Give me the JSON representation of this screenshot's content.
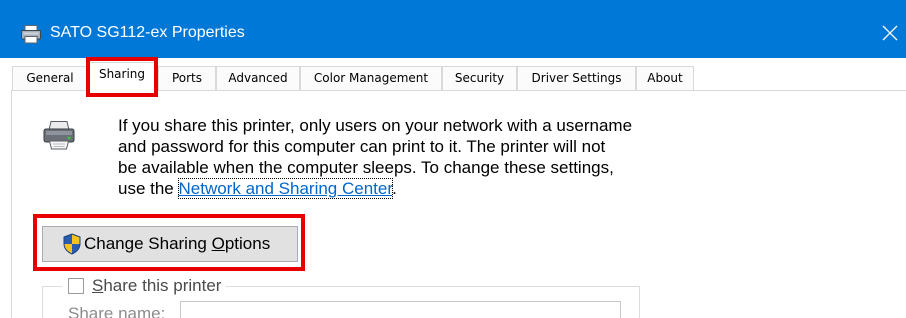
{
  "window": {
    "title": "SATO SG112-ex Properties",
    "title_icon": "printer-icon",
    "close_icon": "close-icon"
  },
  "tabs": [
    {
      "label": "General",
      "selected": false
    },
    {
      "label": "Sharing",
      "selected": true
    },
    {
      "label": "Ports",
      "selected": false
    },
    {
      "label": "Advanced",
      "selected": false
    },
    {
      "label": "Color Management",
      "selected": false
    },
    {
      "label": "Security",
      "selected": false
    },
    {
      "label": "Driver Settings",
      "selected": false
    },
    {
      "label": "About",
      "selected": false
    }
  ],
  "sharing": {
    "printer_icon": "printer-icon",
    "description_lines": [
      "If you share this printer, only users on your network with a username",
      "and password for this computer can print to it. The printer will not",
      "be available when the computer sleeps. To change these settings,"
    ],
    "description_last_prefix": "use the ",
    "link_text": "Network and Sharing Center",
    "description_last_suffix": ".",
    "change_button": {
      "label": "Change Sharing Options",
      "access_key": "O",
      "icon": "uac-shield-icon"
    },
    "share_checkbox": {
      "label": "Share this printer",
      "access_key": "S",
      "checked": false
    },
    "share_name": {
      "label": "Share name:",
      "value": ""
    }
  },
  "colors": {
    "titlebar": "#0078d7",
    "link": "#0066cc",
    "highlight": "#e60000",
    "button_face": "#e1e1e1"
  }
}
